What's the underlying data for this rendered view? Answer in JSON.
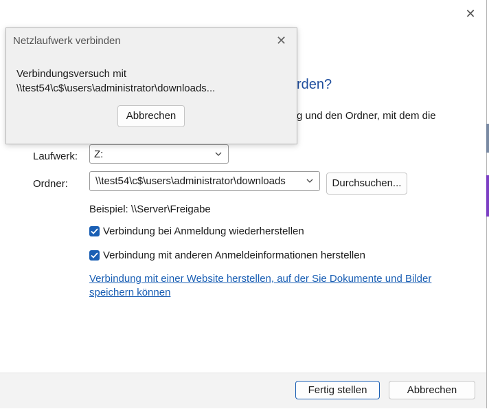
{
  "main_dialog": {
    "heading_fragment": "rden?",
    "intro_fragment": "g und den Ordner, mit dem die",
    "drive_label": "Laufwerk:",
    "drive_value": "Z:",
    "folder_label": "Ordner:",
    "folder_value": "\\\\test54\\c$\\users\\administrator\\downloads",
    "browse_button": "Durchsuchen...",
    "example": "Beispiel: \\\\Server\\Freigabe",
    "reconnect_checkbox": {
      "label": "Verbindung bei Anmeldung wiederherstellen",
      "checked": true
    },
    "other_credentials_checkbox": {
      "label": "Verbindung mit anderen Anmeldeinformationen herstellen",
      "checked": true
    },
    "website_link": "Verbindung mit einer Website herstellen, auf der Sie Dokumente und Bilder speichern können",
    "finish_button": "Fertig stellen",
    "cancel_button": "Abbrechen",
    "close_icon": "close-icon"
  },
  "progress_dialog": {
    "title": "Netzlaufwerk verbinden",
    "message_line1": "Verbindungsversuch mit",
    "message_line2": "\\\\test54\\c$\\users\\administrator\\downloads...",
    "cancel_button": "Abbrechen",
    "close_icon": "close-icon"
  },
  "colors": {
    "accent": "#1a5fb4",
    "heading": "#1f4e9e",
    "dialog_bg": "#f0f0f0"
  }
}
